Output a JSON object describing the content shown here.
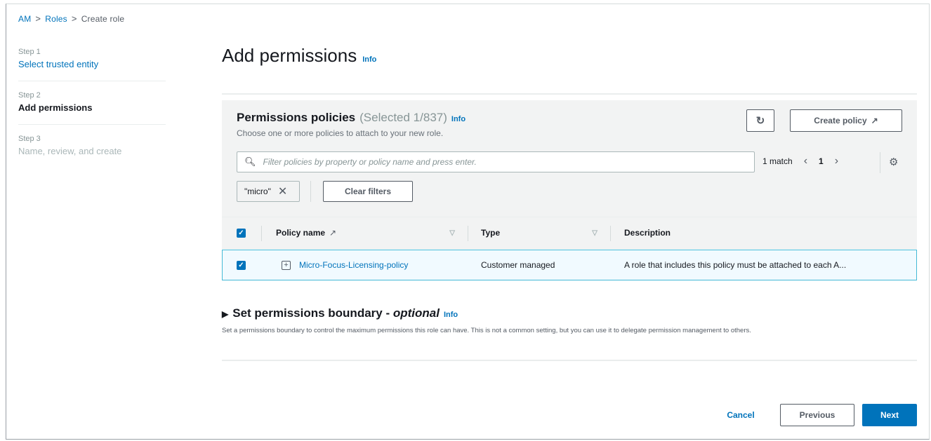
{
  "breadcrumb": {
    "items": [
      "AM",
      "Roles",
      "Create role"
    ]
  },
  "steps": [
    {
      "num": "Step 1",
      "label": "Select trusted entity"
    },
    {
      "num": "Step 2",
      "label": "Add permissions"
    },
    {
      "num": "Step 3",
      "label": "Name, review, and create"
    }
  ],
  "page": {
    "title": "Add permissions",
    "info": "Info"
  },
  "policies": {
    "title": "Permissions policies",
    "selected": "(Selected 1/837)",
    "info": "Info",
    "description": "Choose one or more policies to attach to your new role.",
    "refresh_icon": "refresh-icon",
    "create_label": "Create policy",
    "search_placeholder": "Filter policies by property or policy name and press enter.",
    "match": "1 match",
    "page": "1",
    "filter_token": "\"micro\"",
    "clear_label": "Clear filters",
    "columns": {
      "name": "Policy name",
      "type": "Type",
      "description": "Description"
    },
    "rows": [
      {
        "name": "Micro-Focus-Licensing-policy",
        "type": "Customer managed",
        "description": "A role that includes this policy must be attached to each A..."
      }
    ]
  },
  "boundary": {
    "title": "Set permissions boundary - ",
    "optional": "optional",
    "info": "Info",
    "description": "Set a permissions boundary to control the maximum permissions this role can have. This is not a common setting, but you can use it to delegate permission management to others."
  },
  "footer": {
    "cancel": "Cancel",
    "previous": "Previous",
    "next": "Next"
  },
  "colors": {
    "accent": "#0073bb",
    "primary_button": "#0073bb",
    "selected_row_border": "#44b9d6"
  }
}
